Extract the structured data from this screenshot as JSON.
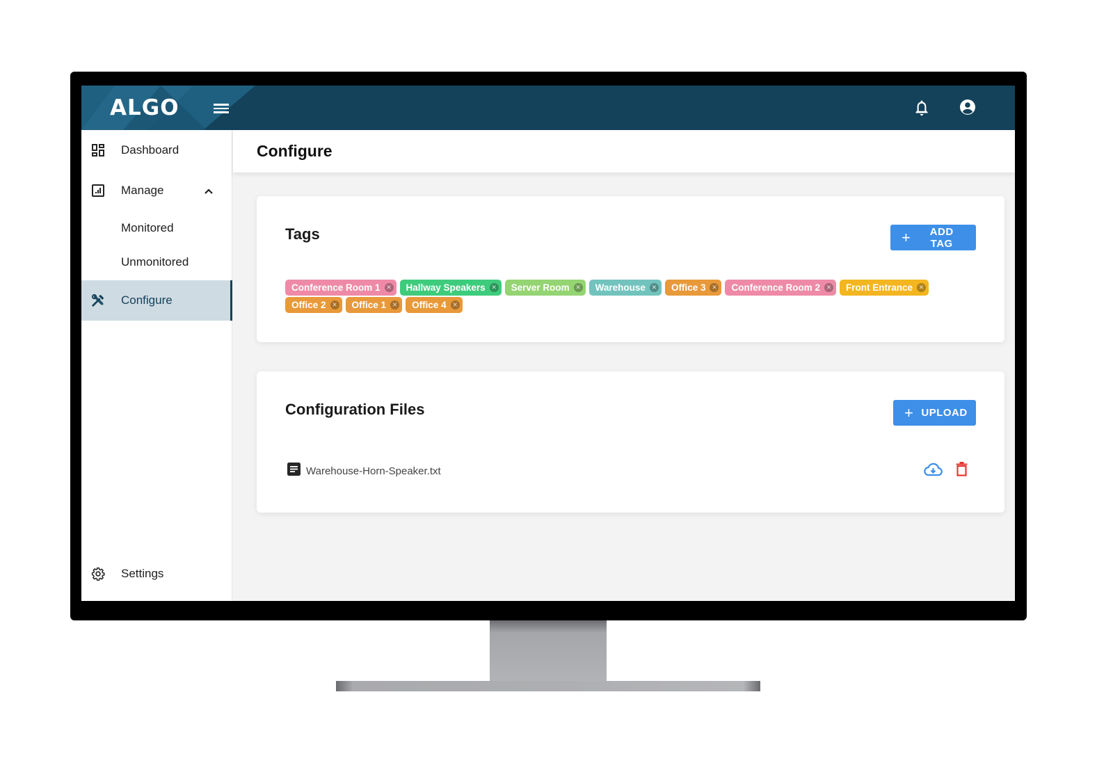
{
  "app": {
    "logo": "ALGO"
  },
  "header": {
    "menu_icon": "hamburger-icon",
    "notifications_icon": "bell-icon",
    "account_icon": "account-circle-icon"
  },
  "sidebar": {
    "items": [
      {
        "label": "Dashboard",
        "icon": "dashboard-icon"
      },
      {
        "label": "Manage",
        "icon": "chart-box-icon",
        "expanded": true
      },
      {
        "label": "Monitored"
      },
      {
        "label": "Unmonitored"
      },
      {
        "label": "Configure",
        "icon": "tools-icon",
        "active": true
      },
      {
        "label": "Settings",
        "icon": "gear-icon"
      }
    ]
  },
  "page": {
    "title": "Configure"
  },
  "tags_card": {
    "title": "Tags",
    "add_button": "ADD TAG",
    "tags": [
      {
        "label": "Conference Room 1",
        "color": "#ee8aa8"
      },
      {
        "label": "Hallway Speakers",
        "color": "#3fcb7c"
      },
      {
        "label": "Server Room",
        "color": "#94d472"
      },
      {
        "label": "Warehouse",
        "color": "#72c3bd"
      },
      {
        "label": "Office 3",
        "color": "#e8993a"
      },
      {
        "label": "Conference Room 2",
        "color": "#ee8aa8"
      },
      {
        "label": "Front Entrance",
        "color": "#f3b520"
      },
      {
        "label": "Office 2",
        "color": "#e8993a"
      },
      {
        "label": "Office 1",
        "color": "#e8993a"
      },
      {
        "label": "Office 4",
        "color": "#e8993a"
      }
    ]
  },
  "files_card": {
    "title": "Configuration Files",
    "upload_button": "UPLOAD",
    "files": [
      {
        "name": "Warehouse-Horn-Speaker.txt"
      }
    ]
  },
  "colors": {
    "topbar": "#13425a",
    "accent": "#3d8fe8",
    "delete": "#e53935",
    "active_nav": "#cfdbe2"
  }
}
